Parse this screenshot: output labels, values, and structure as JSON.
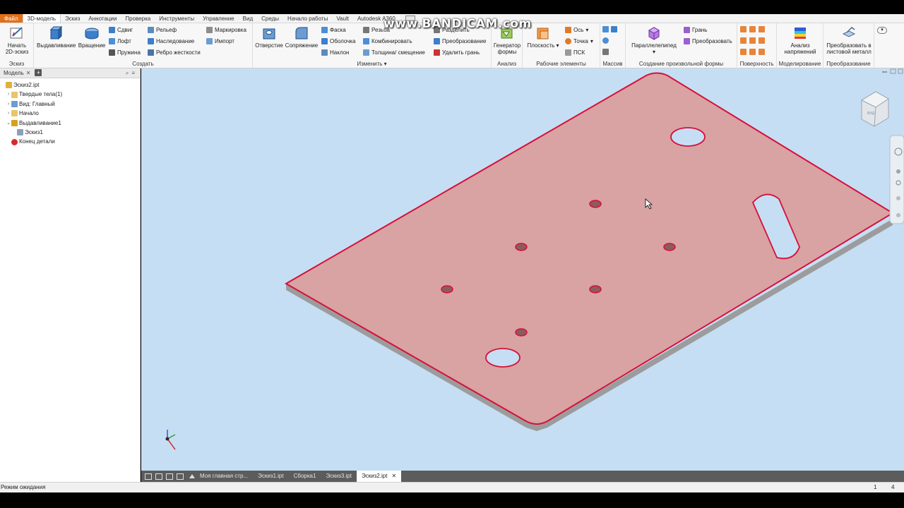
{
  "watermark": "www.BANDICAM.com",
  "menu_tabs": [
    "Файл",
    "3D-модель",
    "Эскиз",
    "Аннотации",
    "Проверка",
    "Инструменты",
    "Управление",
    "Вид",
    "Среды",
    "Начало работы",
    "Vault",
    "Autodesk A360"
  ],
  "ribbon": {
    "sketch": {
      "start_sketch": "Начать 2D-эскиз",
      "title": "Эскиз"
    },
    "create": {
      "extrude": "Выдавливание",
      "revolve": "Вращение",
      "sweep": "Сдвиг",
      "loft": "Лофт",
      "coil": "Пружина",
      "emboss": "Рельеф",
      "derive": "Наследование",
      "rib": "Ребро жесткости",
      "decal": "Маркировка",
      "import": "Импорт",
      "title": "Создать"
    },
    "modify": {
      "hole": "Отверстие",
      "fillet": "Сопряжение",
      "chamfer": "Фаска",
      "shell": "Оболочка",
      "draft": "Наклон",
      "thread": "Резьба",
      "combine": "Комбинировать",
      "thicken": "Толщина/ смещение",
      "split": "Разделить",
      "direct": "Преобразование",
      "delete_face": "Удалить грань",
      "title": "Изменить"
    },
    "analysis": {
      "shape_gen": "Генератор формы",
      "title": "Анализ"
    },
    "work": {
      "plane": "Плоскость",
      "axis": "Ось",
      "point": "Точка",
      "ucs": "ПСК",
      "title": "Рабочие элементы"
    },
    "pattern": {
      "title": "Массив"
    },
    "freeform": {
      "box": "Параллелепипед",
      "face": "Грань",
      "convert": "Преобразовать",
      "title": "Создание произвольной формы"
    },
    "surface": {
      "title": "Поверхность"
    },
    "simulation": {
      "stress": "Анализ напряжений",
      "title": "Моделирование"
    },
    "convert": {
      "sheet_metal": "Преобразовать в листовой металл",
      "title": "Преобразование"
    }
  },
  "browser": {
    "tab": "Модель",
    "tree": [
      {
        "label": "Эскиз2.ipt",
        "indent": 0,
        "toggle": "",
        "icon": "part"
      },
      {
        "label": "Твердые тела(1)",
        "indent": 1,
        "toggle": "›",
        "icon": "folder"
      },
      {
        "label": "Вид: Главный",
        "indent": 1,
        "toggle": "›",
        "icon": "view"
      },
      {
        "label": "Начало",
        "indent": 1,
        "toggle": "›",
        "icon": "folder"
      },
      {
        "label": "Выдавливание1",
        "indent": 1,
        "toggle": "⌄",
        "icon": "extrude"
      },
      {
        "label": "Эскиз1",
        "indent": 2,
        "toggle": "",
        "icon": "sketch"
      },
      {
        "label": "Конец детали",
        "indent": 1,
        "toggle": "",
        "icon": "end"
      }
    ]
  },
  "doc_tabs": [
    "Моя главная стр...",
    "Эскиз1.ipt",
    "Сборка1",
    "Эскиз3.ipt",
    "Эскиз2.ipt"
  ],
  "active_doc": "Эскиз2.ipt",
  "status": {
    "text": "Режим ожидания",
    "n1": "1",
    "n2": "4"
  },
  "viewport": {
    "background": "#c6def4",
    "plate_face": "#d9a2a3",
    "plate_edge": "#d6103a",
    "plate_side": "#9c9c9c",
    "view_cube_label": "ВИД"
  }
}
